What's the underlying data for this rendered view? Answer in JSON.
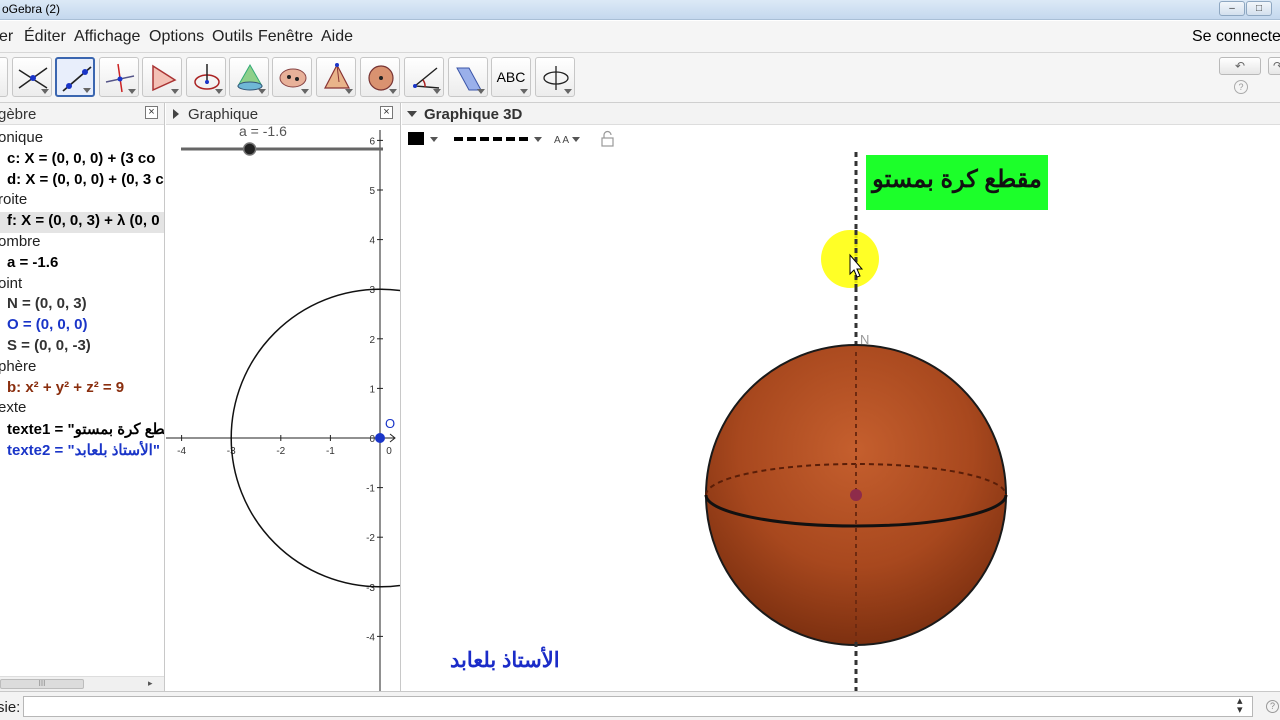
{
  "window": {
    "title": "oGebra (2)",
    "min": "–",
    "max": "□"
  },
  "menu": {
    "items": [
      "er",
      "Éditer",
      "Affichage",
      "Options",
      "Outils",
      "Fenêtre",
      "Aide"
    ],
    "connect": "Se connecte"
  },
  "toolbar": {
    "text_tool_label": "ABC",
    "undo": "↶",
    "redo": "↷",
    "help": "?"
  },
  "algebra": {
    "title": "gèbre",
    "close": "×",
    "rows": [
      {
        "kind": "cat",
        "text": "onique",
        "color": "#222222"
      },
      {
        "kind": "item",
        "text": "c: X = (0, 0, 0) + (3 co",
        "color": "#000000"
      },
      {
        "kind": "item",
        "text": "d: X = (0, 0, 0) + (0, 3 c",
        "color": "#000000"
      },
      {
        "kind": "cat",
        "text": "roite",
        "color": "#222222"
      },
      {
        "kind": "item",
        "text": "f: X = (0, 0, 3) + λ (0, 0",
        "color": "#000000",
        "selected": true
      },
      {
        "kind": "cat",
        "text": "ombre",
        "color": "#222222"
      },
      {
        "kind": "item",
        "text": "a = -1.6",
        "color": "#000000"
      },
      {
        "kind": "cat",
        "text": "oint",
        "color": "#222222"
      },
      {
        "kind": "item",
        "text": "N = (0, 0, 3)",
        "color": "#333333"
      },
      {
        "kind": "item",
        "text": "O = (0, 0, 0)",
        "color": "#1a35c8"
      },
      {
        "kind": "item",
        "text": "S = (0, 0, -3)",
        "color": "#333333"
      },
      {
        "kind": "cat",
        "text": "phère",
        "color": "#222222"
      },
      {
        "kind": "item",
        "text": "b: x² + y² + z² = 9",
        "color": "#8a2e0e"
      },
      {
        "kind": "cat",
        "text": "exte",
        "color": "#222222"
      },
      {
        "kind": "item",
        "text": "texte1 = \"مقطع كرة بمستو",
        "color": "#000000"
      },
      {
        "kind": "item",
        "text": "texte2 = \"الأستاذ بلعابد\"",
        "color": "#1a35c8"
      }
    ],
    "scroll_thumb": "III",
    "scroll_arrow": "▸"
  },
  "graphics2d": {
    "title": "Graphique",
    "close": "×",
    "slider_label": "a = -1.6",
    "slider_value": -1.6,
    "slider_min": -5,
    "slider_max": 5,
    "y_ticks": [
      "6",
      "5",
      "4",
      "3",
      "2",
      "1",
      "0",
      "-1",
      "-2",
      "-3",
      "-4"
    ],
    "x_ticks": [
      "-4",
      "-3",
      "-2",
      "-1",
      "0"
    ],
    "origin_label": "O",
    "circle_radius": 3,
    "point_color": "#1a35c8"
  },
  "graphics3d": {
    "title": "Graphique 3D",
    "text1": "مقطع كرة بمستو",
    "text2": "الأستاذ بلعابد",
    "point_label_N": "N",
    "label_bg": "#1cff2a",
    "sphere_color": "#a8481e",
    "text2_color": "#1b2cc8",
    "style_bar": {
      "font_size_label": "A A"
    }
  },
  "input": {
    "label": "sie:",
    "value": "",
    "help": "?"
  }
}
